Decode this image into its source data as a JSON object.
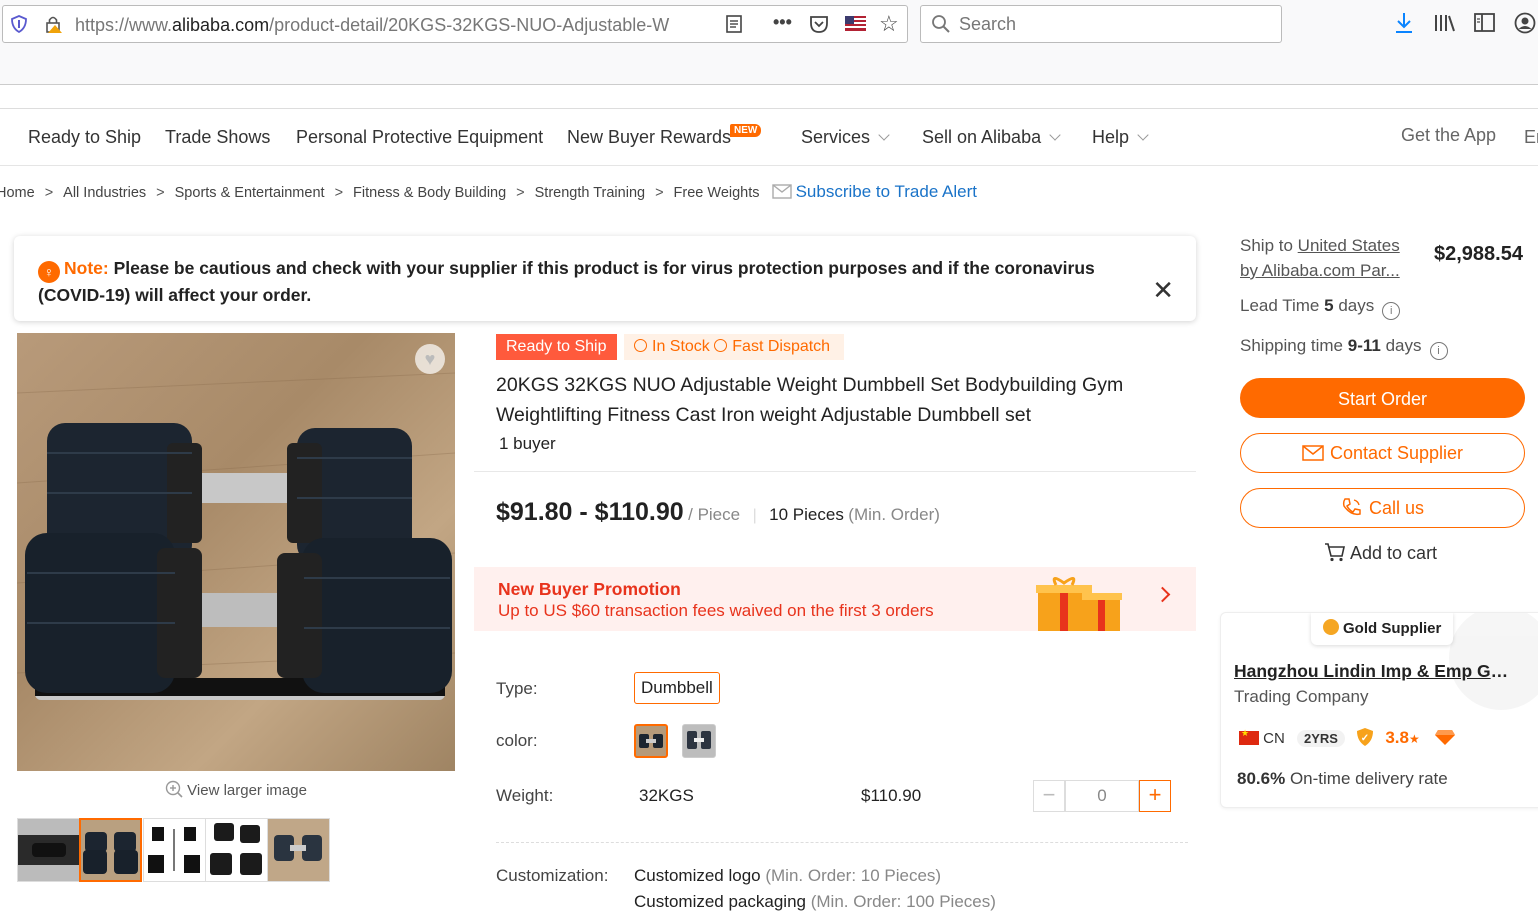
{
  "browser": {
    "url_prefix": "https://www.",
    "url_domain": "alibaba.com",
    "url_path": "/product-detail/20KGS-32KGS-NUO-Adjustable-W",
    "search_placeholder": "Search"
  },
  "nav": {
    "items": [
      {
        "label": "Ready to Ship"
      },
      {
        "label": "Trade Shows"
      },
      {
        "label": "Personal Protective Equipment"
      },
      {
        "label": "New Buyer Rewards",
        "badge": "NEW"
      },
      {
        "label": "Services"
      },
      {
        "label": "Sell on Alibaba"
      },
      {
        "label": "Help"
      }
    ],
    "get_app": "Get the App",
    "lang": "En"
  },
  "breadcrumb": {
    "items": [
      "Home",
      "All Industries",
      "Sports & Entertainment",
      "Fitness & Body Building",
      "Strength Training",
      "Free Weights"
    ],
    "subscribe": "Subscribe to Trade Alert"
  },
  "note": {
    "label": "Note:",
    "text": " Please be cautious and check with your supplier if this product is for virus protection purposes and if the coronavirus (COVID-19) will affect your order."
  },
  "gallery": {
    "view_larger": "View larger image"
  },
  "product": {
    "badge_ready": "Ready to Ship",
    "badge_stock": "In Stock",
    "badge_dispatch": "Fast Dispatch",
    "title": "20KGS 32KGS NUO Adjustable Weight Dumbbell Set Bodybuilding Gym Weightlifting Fitness Cast Iron weight Adjustable Dumbbell set",
    "buyers": "1 buyer",
    "price": "$91.80 - $110.90",
    "unit": "/ Piece",
    "min_qty": "10 Pieces",
    "min_order": "(Min. Order)"
  },
  "promo": {
    "title": "New Buyer Promotion",
    "subtitle": "Up to US $60 transaction fees waived on the first 3 orders"
  },
  "attributes": {
    "type_label": "Type:",
    "type_value": "Dumbbell",
    "color_label": "color:",
    "weight_label": "Weight:",
    "weight_value": "32KGS",
    "weight_price": "$110.90",
    "quantity": "0",
    "customization_label": "Customization:",
    "custom_1": "Customized logo",
    "custom_1_min": "(Min. Order: 10 Pieces)",
    "custom_2": "Customized packaging",
    "custom_2_min": "(Min. Order: 100 Pieces)"
  },
  "sidebar": {
    "ship_to_prefix": "Ship to",
    "ship_country": "United States",
    "ship_via": "by Alibaba.com Par...",
    "ship_price": "$2,988.54",
    "lead_time_label": "Lead Time",
    "lead_time_value": "5",
    "lead_time_unit": "days",
    "shipping_label": "Shipping time",
    "shipping_value": "9-11",
    "shipping_unit": "days",
    "start_order": "Start Order",
    "contact_supplier": "Contact Supplier",
    "call_us": "Call us",
    "add_to_cart": "Add to cart"
  },
  "supplier": {
    "tag": "Gold Supplier",
    "name": "Hangzhou Lindin Imp & Emp Gro...",
    "type": "Trading Company",
    "country": "CN",
    "years": "2YRS",
    "rating": "3.8",
    "delivery_rate": "80.6%",
    "delivery_label": "On-time delivery rate"
  },
  "colors": {
    "accent": "#ff6a00",
    "promo_red": "#e8331c",
    "link_blue": "#1a73c8"
  }
}
